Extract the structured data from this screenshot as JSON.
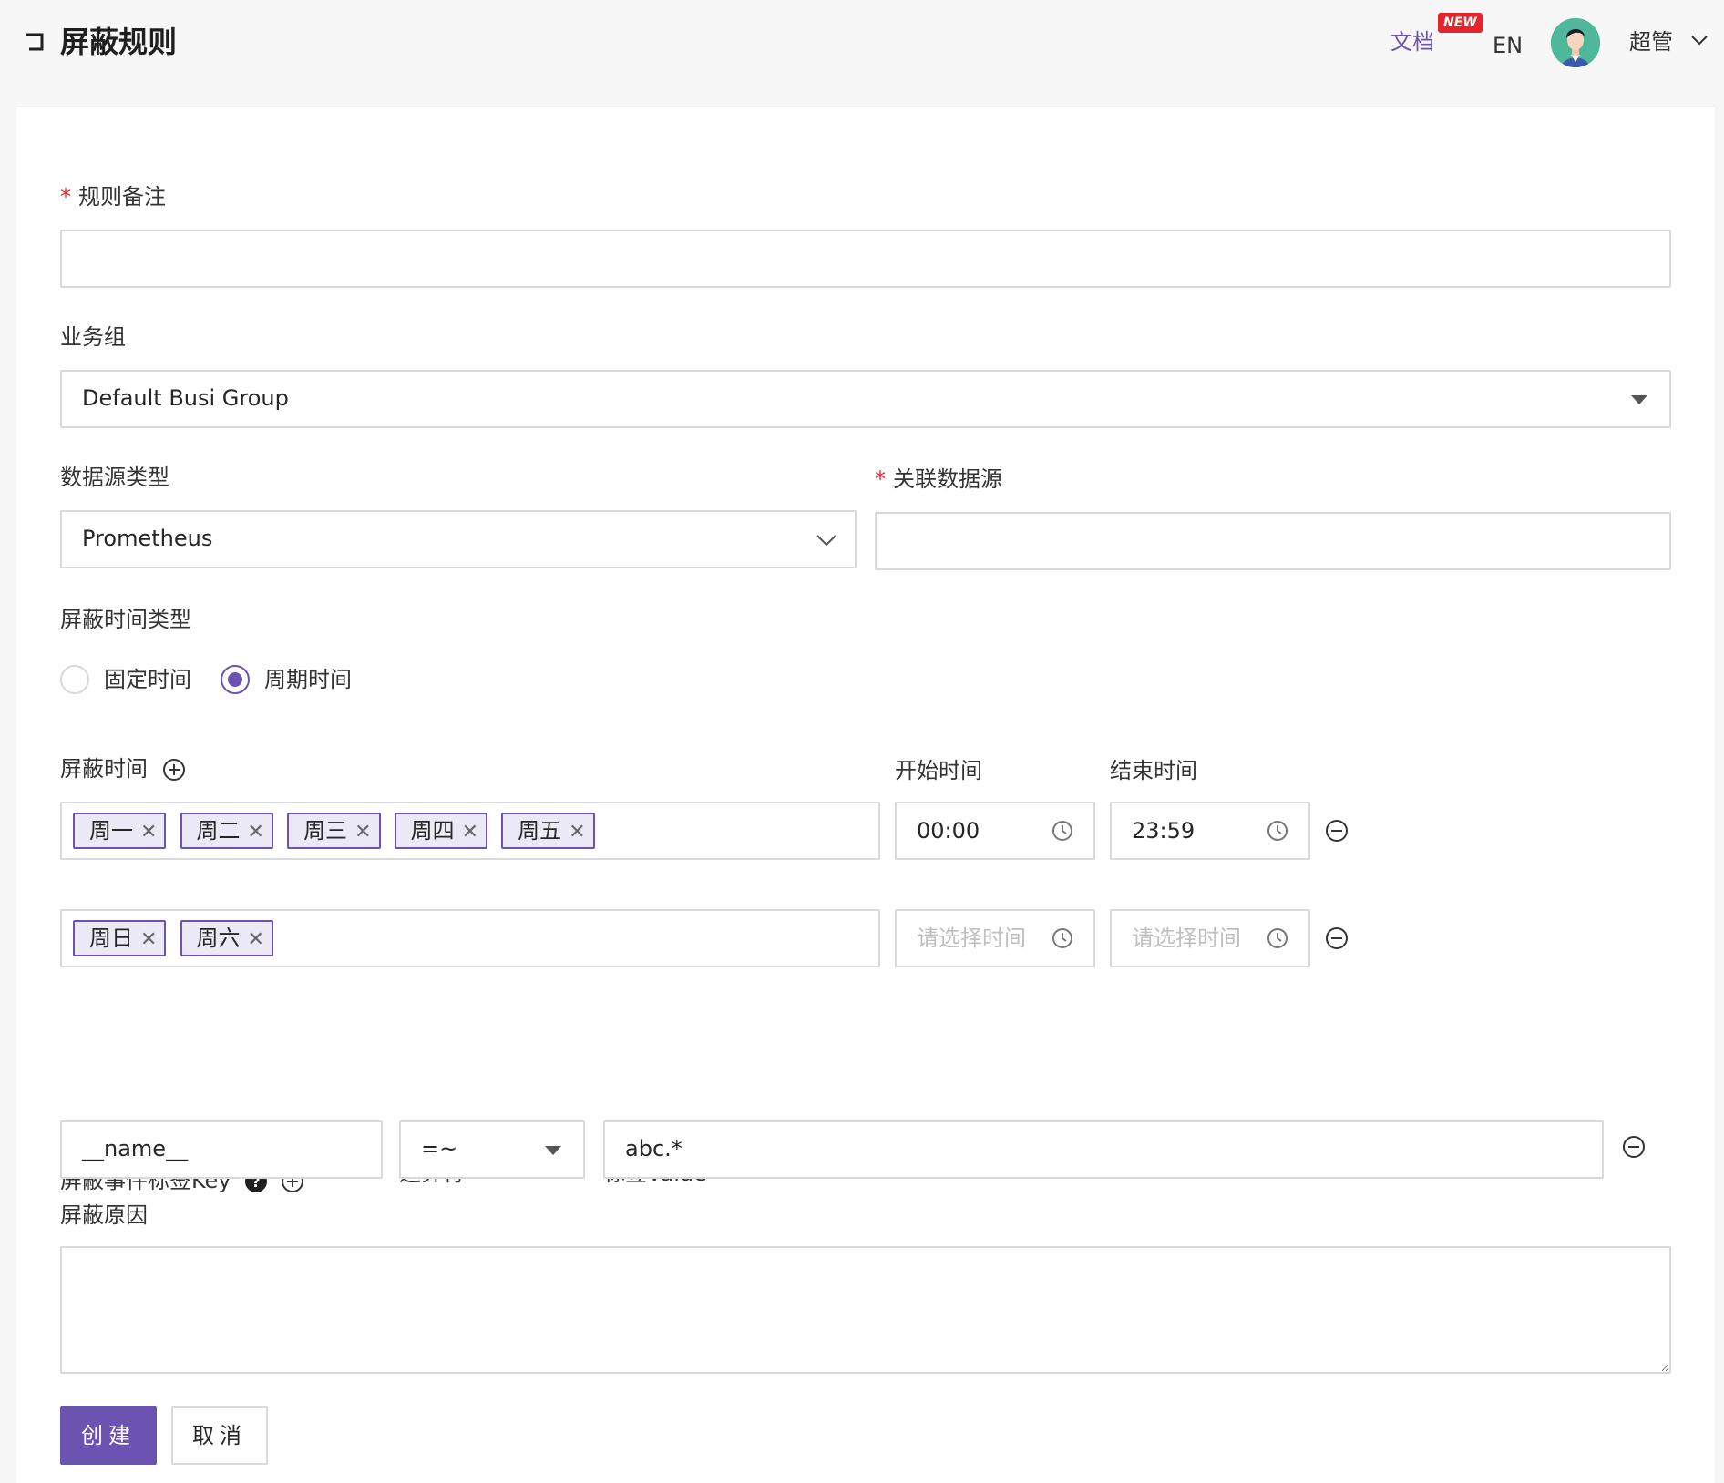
{
  "header": {
    "title": "屏蔽规则",
    "doc_link": "文档",
    "new_badge": "NEW",
    "lang": "EN",
    "user": "超管"
  },
  "form": {
    "remark_label": "规则备注",
    "remark_value": "",
    "busi_group_label": "业务组",
    "busi_group_value": "Default Busi Group",
    "datasource_type_label": "数据源类型",
    "datasource_type_value": "Prometheus",
    "datasource_label": "关联数据源",
    "datasource_value": "",
    "time_type_label": "屏蔽时间类型",
    "time_type_options": [
      "固定时间",
      "周期时间"
    ],
    "time_type_selected": "周期时间",
    "mute_time_label": "屏蔽时间",
    "start_time_label": "开始时间",
    "end_time_label": "结束时间",
    "periods": [
      {
        "days": [
          "周一",
          "周二",
          "周三",
          "周四",
          "周五"
        ],
        "start": "00:00",
        "end": "23:59"
      },
      {
        "days": [
          "周日",
          "周六"
        ],
        "start": "",
        "end": ""
      }
    ],
    "time_placeholder": "请选择时间",
    "tag_key_label": "屏蔽事件标签Key",
    "operator_label": "运算符",
    "tag_value_label": "标签Value",
    "tag_rows": [
      {
        "key": "__name__",
        "operator": "=~",
        "value": "abc.*"
      }
    ],
    "cause_label": "屏蔽原因",
    "cause_value": ""
  },
  "buttons": {
    "create": "创建",
    "cancel": "取消"
  },
  "colors": {
    "primary": "#6c53b1",
    "required": "#e5242b",
    "border": "#d9d9d9"
  },
  "icons": [
    "back-icon",
    "user-avatar",
    "chevron-down-icon",
    "caret-down-icon",
    "plus-circle-icon",
    "minus-circle-icon",
    "clock-icon",
    "question-circle-icon",
    "close-icon",
    "resize-handle-icon"
  ]
}
